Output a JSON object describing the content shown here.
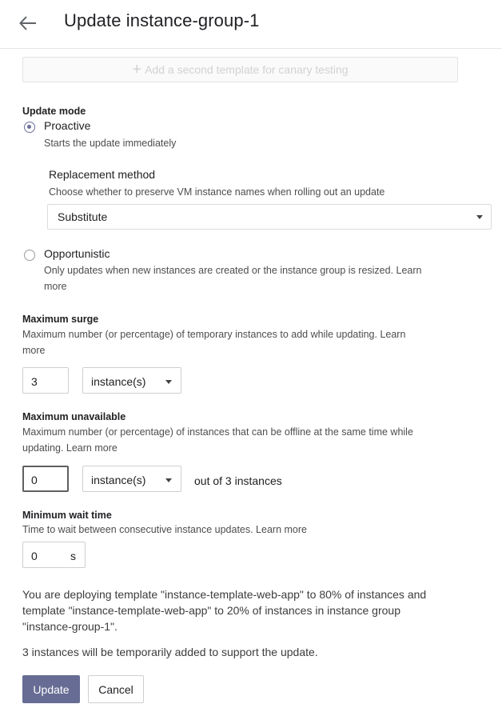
{
  "header": {
    "back_icon": "arrow-left-icon",
    "title": "Update instance-group-1"
  },
  "canary": {
    "icon": "plus-icon",
    "label": "Add a second template for canary testing"
  },
  "update_mode": {
    "label": "Update mode",
    "proactive": {
      "label": "Proactive",
      "description": "Starts the update immediately",
      "selected": true
    },
    "replacement": {
      "label": "Replacement method",
      "description": "Choose whether to preserve VM instance names when rolling out an update",
      "value": "Substitute"
    },
    "opportunistic": {
      "label": "Opportunistic",
      "description_1": "Only updates when new instances are created or the instance group is resized. Learn",
      "description_2": "more",
      "selected": false
    }
  },
  "max_surge": {
    "label": "Maximum surge",
    "description_1": "Maximum number (or percentage) of temporary instances to add while updating. Learn",
    "description_2": "more",
    "value": "3",
    "unit": "instance(s)"
  },
  "max_unavailable": {
    "label": "Maximum unavailable",
    "description_1": "Maximum number (or percentage) of instances that can be offline at the same time while",
    "description_2": "updating. Learn more",
    "value": "0",
    "unit": "instance(s)",
    "suffix": "out of 3 instances"
  },
  "min_wait": {
    "label": "Minimum wait time",
    "description": "Time to wait between consecutive instance updates. Learn more",
    "value": "0",
    "unit": "s"
  },
  "summary": {
    "line_1": "You are deploying template \"instance-template-web-app\" to 80% of instances and",
    "line_2": "template \"instance-template-web-app\" to 20% of instances in instance group",
    "line_3": "\"instance-group-1\".",
    "line_4": "3 instances will be temporarily added to support the update."
  },
  "actions": {
    "update": "Update",
    "cancel": "Cancel"
  }
}
